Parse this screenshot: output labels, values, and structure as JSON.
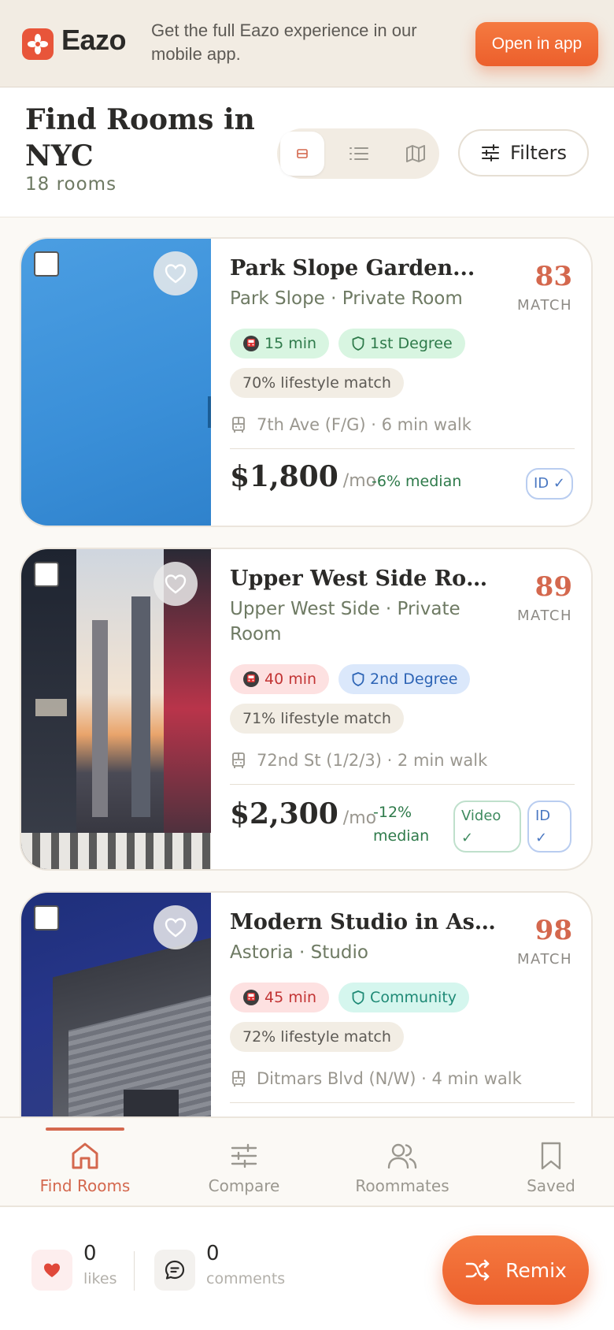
{
  "banner": {
    "logo_text": "Eazo",
    "message": "Get the full Eazo experience in our mobile app.",
    "open_app_label": "Open in app",
    "accent": "#ec5f2c"
  },
  "header": {
    "title": "Find Rooms in NYC",
    "count": "18 rooms",
    "filters_label": "Filters",
    "views": [
      "card-view-icon",
      "list-view-icon",
      "map-view-icon"
    ],
    "active_view": "card-view-icon"
  },
  "listings": [
    {
      "name": "Park Slope Garden...",
      "subtitle": "Park Slope · Private Room",
      "match": "83",
      "match_label": "MATCH",
      "commute": "15 min",
      "commute_color": "green",
      "trust": "1st Degree",
      "trust_color": "green",
      "lifestyle": "70% lifestyle match",
      "transit": "7th Ave (F/G) · 6 min walk",
      "price": "$1,800",
      "per": "/mo",
      "median": "-6% median",
      "badges": [
        "ID ✓"
      ],
      "photo": "blue-sky"
    },
    {
      "name": "Upper West Side Room...",
      "subtitle": "Upper West Side · Private Room",
      "match": "89",
      "match_label": "MATCH",
      "commute": "40 min",
      "commute_color": "red",
      "trust": "2nd Degree",
      "trust_color": "blue",
      "lifestyle": "71% lifestyle match",
      "transit": "72nd St (1/2/3) · 2 min walk",
      "price": "$2,300",
      "per": "/mo",
      "median": "-12% median",
      "badges": [
        "Video ✓",
        "ID ✓"
      ],
      "photo": "city-street"
    },
    {
      "name": "Modern Studio in Astoria",
      "subtitle": "Astoria · Studio",
      "match": "98",
      "match_label": "MATCH",
      "commute": "45 min",
      "commute_color": "red",
      "trust": "Community",
      "trust_color": "teal",
      "lifestyle": "72% lifestyle match",
      "transit": "Ditmars Blvd (N/W) · 4 min walk",
      "photo": "modern-building"
    }
  ],
  "nav": {
    "items": [
      {
        "label": "Find Rooms",
        "icon": "home-icon",
        "active": true
      },
      {
        "label": "Compare",
        "icon": "sliders-icon",
        "active": false
      },
      {
        "label": "Roommates",
        "icon": "people-icon",
        "active": false
      },
      {
        "label": "Saved",
        "icon": "bookmark-icon",
        "active": false
      }
    ]
  },
  "social": {
    "likes_count": "0",
    "likes_label": "likes",
    "comments_count": "0",
    "comments_label": "comments",
    "remix_label": "Remix"
  }
}
